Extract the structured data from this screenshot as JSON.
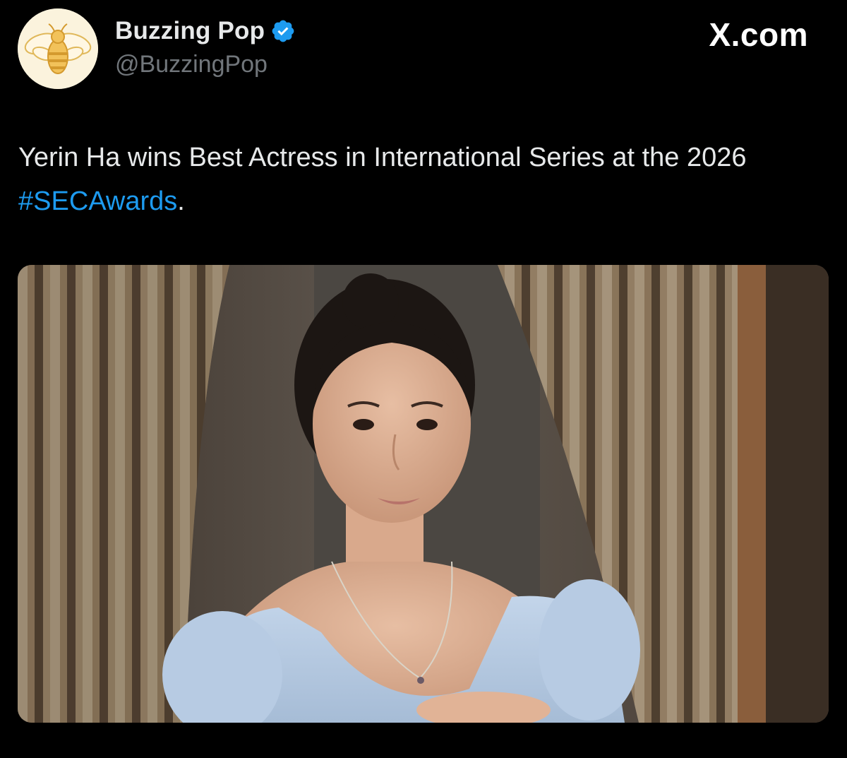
{
  "account": {
    "display_name": "Buzzing Pop",
    "handle": "@BuzzingPop",
    "verified": true,
    "avatar_icon": "bee-icon",
    "verified_icon": "verified-badge-icon",
    "verified_color": "#1d9bf0"
  },
  "watermark": {
    "label": "X.com"
  },
  "tweet": {
    "text_before": "Yerin Ha wins Best Actress in International Series at the 2026 ",
    "hashtag": "#SECAwards",
    "text_after": ".",
    "hashtag_color": "#1d9bf0"
  },
  "media": {
    "type": "photo",
    "subject": "woman in light blue puff-sleeve gown standing between patterned curtains"
  },
  "colors": {
    "background": "#000000",
    "primary_text": "#e7e9ea",
    "secondary_text": "#71767b"
  }
}
